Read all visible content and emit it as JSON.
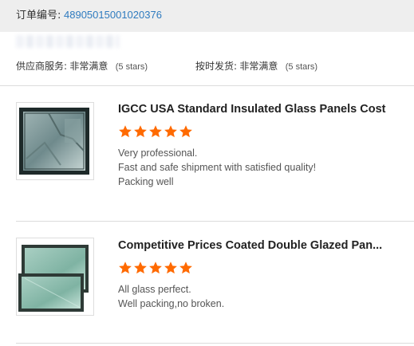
{
  "order": {
    "label": "订单编号:",
    "number": "48905015001020376"
  },
  "buyer": {
    "name": "****"
  },
  "ratings": {
    "supplier_label": "供应商服务:",
    "supplier_value": "非常满意",
    "supplier_stars": "(5 stars)",
    "shipping_label": "按时发货:",
    "shipping_value": "非常满意",
    "shipping_stars": "(5 stars)"
  },
  "colors": {
    "accent_link": "#2f7bbf",
    "star": "#ff6a00",
    "header_bg": "#eeeeee"
  },
  "reviews": [
    {
      "title": "IGCC USA Standard Insulated Glass Panels Cost",
      "rating": 5,
      "lines": [
        "Very professional.",
        "Fast and safe shipment with satisfied quality!",
        "Packing well"
      ],
      "thumbnail_icon": "insulated-glass-panel-image"
    },
    {
      "title": "Competitive Prices Coated Double Glazed Pan...",
      "rating": 5,
      "lines": [
        "All glass perfect.",
        "Well packing,no broken."
      ],
      "thumbnail_icon": "double-glazed-glass-image"
    }
  ]
}
